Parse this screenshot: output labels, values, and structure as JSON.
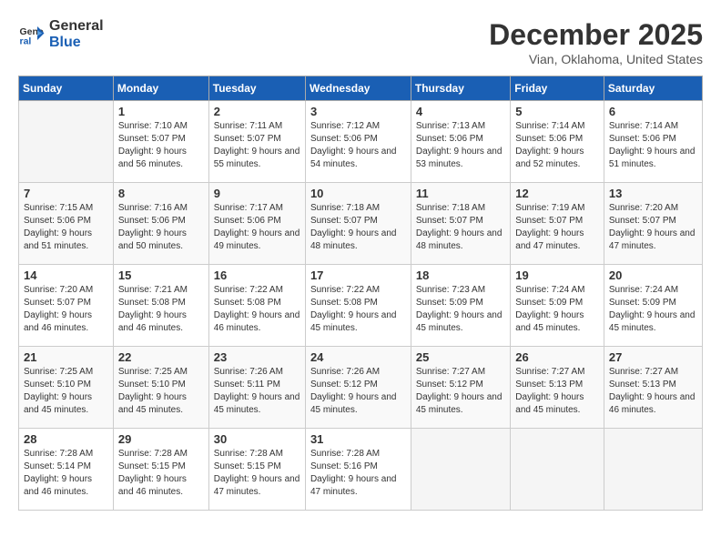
{
  "logo": {
    "line1": "General",
    "line2": "Blue"
  },
  "title": "December 2025",
  "subtitle": "Vian, Oklahoma, United States",
  "days_header": [
    "Sunday",
    "Monday",
    "Tuesday",
    "Wednesday",
    "Thursday",
    "Friday",
    "Saturday"
  ],
  "weeks": [
    [
      {
        "num": "",
        "sunrise": "",
        "sunset": "",
        "daylight": ""
      },
      {
        "num": "1",
        "sunrise": "Sunrise: 7:10 AM",
        "sunset": "Sunset: 5:07 PM",
        "daylight": "Daylight: 9 hours and 56 minutes."
      },
      {
        "num": "2",
        "sunrise": "Sunrise: 7:11 AM",
        "sunset": "Sunset: 5:07 PM",
        "daylight": "Daylight: 9 hours and 55 minutes."
      },
      {
        "num": "3",
        "sunrise": "Sunrise: 7:12 AM",
        "sunset": "Sunset: 5:06 PM",
        "daylight": "Daylight: 9 hours and 54 minutes."
      },
      {
        "num": "4",
        "sunrise": "Sunrise: 7:13 AM",
        "sunset": "Sunset: 5:06 PM",
        "daylight": "Daylight: 9 hours and 53 minutes."
      },
      {
        "num": "5",
        "sunrise": "Sunrise: 7:14 AM",
        "sunset": "Sunset: 5:06 PM",
        "daylight": "Daylight: 9 hours and 52 minutes."
      },
      {
        "num": "6",
        "sunrise": "Sunrise: 7:14 AM",
        "sunset": "Sunset: 5:06 PM",
        "daylight": "Daylight: 9 hours and 51 minutes."
      }
    ],
    [
      {
        "num": "7",
        "sunrise": "Sunrise: 7:15 AM",
        "sunset": "Sunset: 5:06 PM",
        "daylight": "Daylight: 9 hours and 51 minutes."
      },
      {
        "num": "8",
        "sunrise": "Sunrise: 7:16 AM",
        "sunset": "Sunset: 5:06 PM",
        "daylight": "Daylight: 9 hours and 50 minutes."
      },
      {
        "num": "9",
        "sunrise": "Sunrise: 7:17 AM",
        "sunset": "Sunset: 5:06 PM",
        "daylight": "Daylight: 9 hours and 49 minutes."
      },
      {
        "num": "10",
        "sunrise": "Sunrise: 7:18 AM",
        "sunset": "Sunset: 5:07 PM",
        "daylight": "Daylight: 9 hours and 48 minutes."
      },
      {
        "num": "11",
        "sunrise": "Sunrise: 7:18 AM",
        "sunset": "Sunset: 5:07 PM",
        "daylight": "Daylight: 9 hours and 48 minutes."
      },
      {
        "num": "12",
        "sunrise": "Sunrise: 7:19 AM",
        "sunset": "Sunset: 5:07 PM",
        "daylight": "Daylight: 9 hours and 47 minutes."
      },
      {
        "num": "13",
        "sunrise": "Sunrise: 7:20 AM",
        "sunset": "Sunset: 5:07 PM",
        "daylight": "Daylight: 9 hours and 47 minutes."
      }
    ],
    [
      {
        "num": "14",
        "sunrise": "Sunrise: 7:20 AM",
        "sunset": "Sunset: 5:07 PM",
        "daylight": "Daylight: 9 hours and 46 minutes."
      },
      {
        "num": "15",
        "sunrise": "Sunrise: 7:21 AM",
        "sunset": "Sunset: 5:08 PM",
        "daylight": "Daylight: 9 hours and 46 minutes."
      },
      {
        "num": "16",
        "sunrise": "Sunrise: 7:22 AM",
        "sunset": "Sunset: 5:08 PM",
        "daylight": "Daylight: 9 hours and 46 minutes."
      },
      {
        "num": "17",
        "sunrise": "Sunrise: 7:22 AM",
        "sunset": "Sunset: 5:08 PM",
        "daylight": "Daylight: 9 hours and 45 minutes."
      },
      {
        "num": "18",
        "sunrise": "Sunrise: 7:23 AM",
        "sunset": "Sunset: 5:09 PM",
        "daylight": "Daylight: 9 hours and 45 minutes."
      },
      {
        "num": "19",
        "sunrise": "Sunrise: 7:24 AM",
        "sunset": "Sunset: 5:09 PM",
        "daylight": "Daylight: 9 hours and 45 minutes."
      },
      {
        "num": "20",
        "sunrise": "Sunrise: 7:24 AM",
        "sunset": "Sunset: 5:09 PM",
        "daylight": "Daylight: 9 hours and 45 minutes."
      }
    ],
    [
      {
        "num": "21",
        "sunrise": "Sunrise: 7:25 AM",
        "sunset": "Sunset: 5:10 PM",
        "daylight": "Daylight: 9 hours and 45 minutes."
      },
      {
        "num": "22",
        "sunrise": "Sunrise: 7:25 AM",
        "sunset": "Sunset: 5:10 PM",
        "daylight": "Daylight: 9 hours and 45 minutes."
      },
      {
        "num": "23",
        "sunrise": "Sunrise: 7:26 AM",
        "sunset": "Sunset: 5:11 PM",
        "daylight": "Daylight: 9 hours and 45 minutes."
      },
      {
        "num": "24",
        "sunrise": "Sunrise: 7:26 AM",
        "sunset": "Sunset: 5:12 PM",
        "daylight": "Daylight: 9 hours and 45 minutes."
      },
      {
        "num": "25",
        "sunrise": "Sunrise: 7:27 AM",
        "sunset": "Sunset: 5:12 PM",
        "daylight": "Daylight: 9 hours and 45 minutes."
      },
      {
        "num": "26",
        "sunrise": "Sunrise: 7:27 AM",
        "sunset": "Sunset: 5:13 PM",
        "daylight": "Daylight: 9 hours and 45 minutes."
      },
      {
        "num": "27",
        "sunrise": "Sunrise: 7:27 AM",
        "sunset": "Sunset: 5:13 PM",
        "daylight": "Daylight: 9 hours and 46 minutes."
      }
    ],
    [
      {
        "num": "28",
        "sunrise": "Sunrise: 7:28 AM",
        "sunset": "Sunset: 5:14 PM",
        "daylight": "Daylight: 9 hours and 46 minutes."
      },
      {
        "num": "29",
        "sunrise": "Sunrise: 7:28 AM",
        "sunset": "Sunset: 5:15 PM",
        "daylight": "Daylight: 9 hours and 46 minutes."
      },
      {
        "num": "30",
        "sunrise": "Sunrise: 7:28 AM",
        "sunset": "Sunset: 5:15 PM",
        "daylight": "Daylight: 9 hours and 47 minutes."
      },
      {
        "num": "31",
        "sunrise": "Sunrise: 7:28 AM",
        "sunset": "Sunset: 5:16 PM",
        "daylight": "Daylight: 9 hours and 47 minutes."
      },
      {
        "num": "",
        "sunrise": "",
        "sunset": "",
        "daylight": ""
      },
      {
        "num": "",
        "sunrise": "",
        "sunset": "",
        "daylight": ""
      },
      {
        "num": "",
        "sunrise": "",
        "sunset": "",
        "daylight": ""
      }
    ]
  ]
}
